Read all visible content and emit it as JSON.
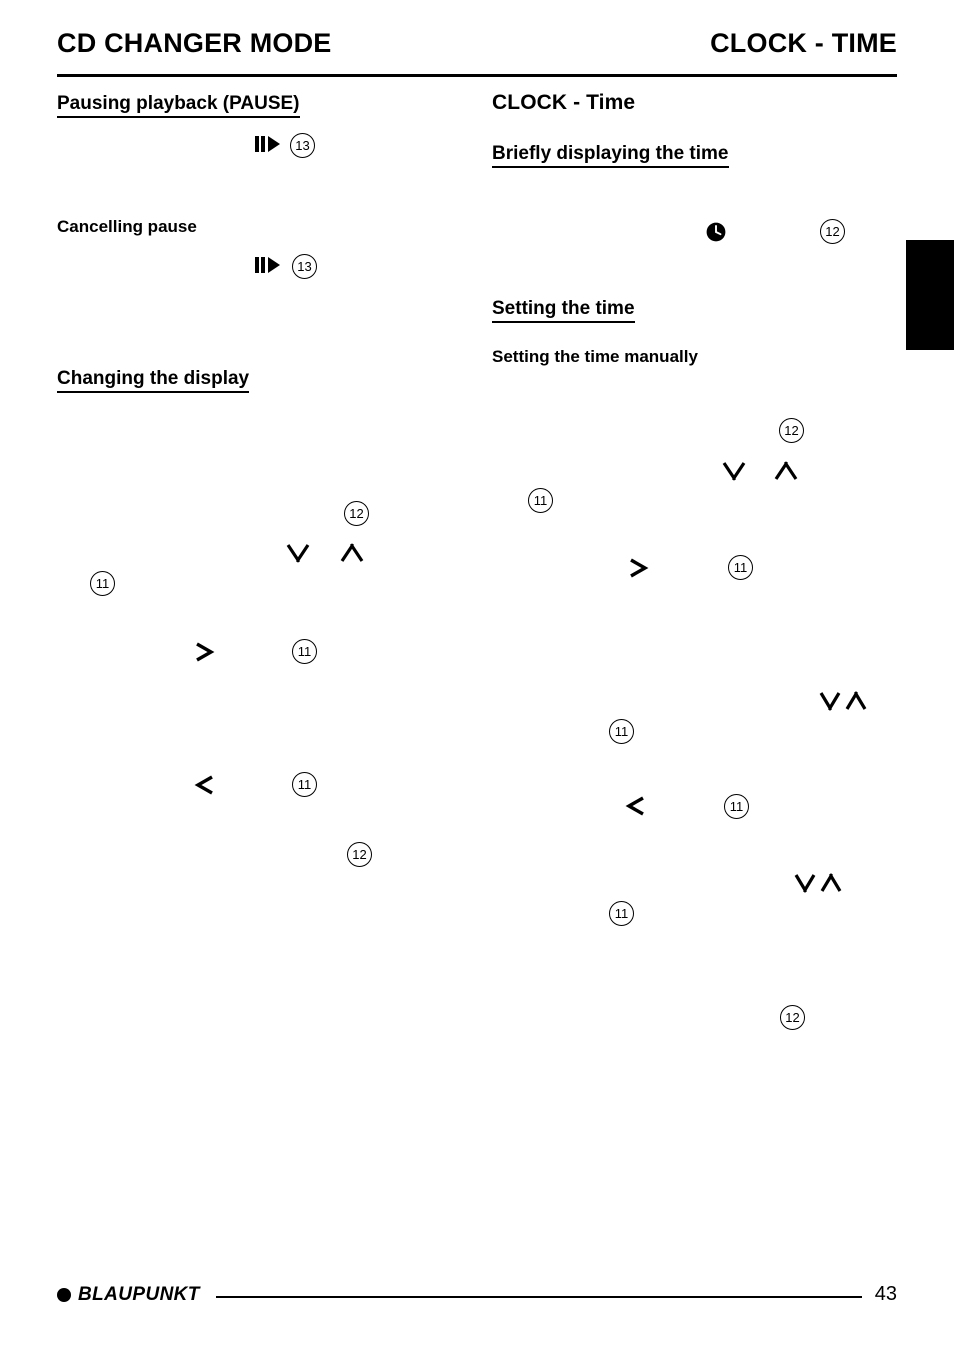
{
  "header": {
    "left_title": "CD CHANGER MODE",
    "right_title": "CLOCK - TIME"
  },
  "left_column": {
    "heading_pause": "Pausing playback (PAUSE)",
    "heading_cancel_pause": "Cancelling pause",
    "heading_changing_display": "Changing the display",
    "bubbles": [
      {
        "label": "13"
      },
      {
        "label": "13"
      },
      {
        "label": "12"
      },
      {
        "label": "11"
      },
      {
        "label": "11"
      },
      {
        "label": "11"
      },
      {
        "label": "12"
      }
    ],
    "icons": [
      {
        "name": "pause-play-icon"
      },
      {
        "name": "pause-play-icon"
      },
      {
        "name": "down-arrow-icon"
      },
      {
        "name": "up-arrow-icon"
      },
      {
        "name": "right-chevron-icon"
      },
      {
        "name": "left-chevron-icon"
      }
    ]
  },
  "right_column": {
    "heading_clock_time": "CLOCK - Time",
    "heading_briefly_displaying": "Briefly displaying the time",
    "heading_setting_time": "Setting the time",
    "heading_setting_manually": "Setting the time manually",
    "bubbles": [
      {
        "label": "12"
      },
      {
        "label": "12"
      },
      {
        "label": "11"
      },
      {
        "label": "11"
      },
      {
        "label": "11"
      },
      {
        "label": "11"
      },
      {
        "label": "11"
      },
      {
        "label": "12"
      }
    ],
    "icons": [
      {
        "name": "clock-icon"
      },
      {
        "name": "down-arrow-icon"
      },
      {
        "name": "up-arrow-icon"
      },
      {
        "name": "right-chevron-icon"
      },
      {
        "name": "down-arrow-icon"
      },
      {
        "name": "up-arrow-icon"
      },
      {
        "name": "left-chevron-icon"
      },
      {
        "name": "down-arrow-icon"
      },
      {
        "name": "up-arrow-icon"
      }
    ]
  },
  "footer": {
    "brand": "BLAUPUNKT",
    "page_number": "43"
  }
}
